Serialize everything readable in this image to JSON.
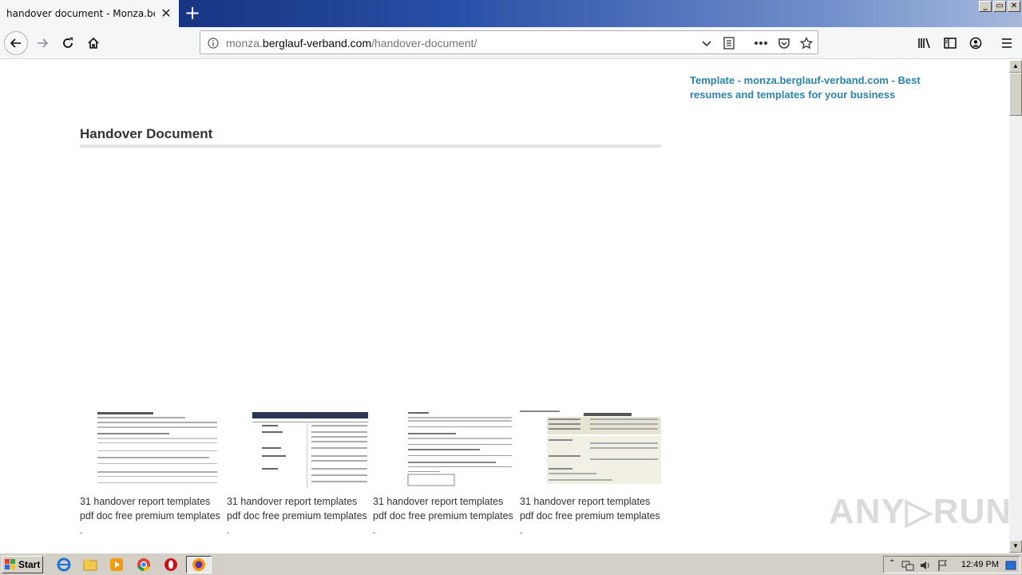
{
  "browser": {
    "tab_title": "handover document - Monza.berglauf-",
    "tab_close": "✕",
    "new_tab": "+",
    "url_prefix": "monza.",
    "url_host": "berglauf-verband.com",
    "url_path": "/handover-document/",
    "window_controls": [
      "_",
      "▭",
      "✕"
    ]
  },
  "page": {
    "sidebar_link": "Template - monza.berglauf-verband.com - Best resumes and templates for your business",
    "title": "Handover Document",
    "thumbnails": [
      {
        "caption": "31 handover report templates pdf doc free premium templates",
        "dot": "."
      },
      {
        "caption": "31 handover report templates pdf doc free premium templates",
        "dot": "."
      },
      {
        "caption": "31 handover report templates pdf doc free premium templates",
        "dot": "."
      },
      {
        "caption": "31 handover report templates pdf doc free premium templates",
        "dot": "."
      }
    ],
    "watermark": "ANY▷RUN"
  },
  "taskbar": {
    "start_label": "Start",
    "clock": "12:49 PM"
  },
  "colors": {
    "link": "#2b84a8",
    "title_text": "#333333",
    "tab_bg": "#f5f6f7"
  }
}
